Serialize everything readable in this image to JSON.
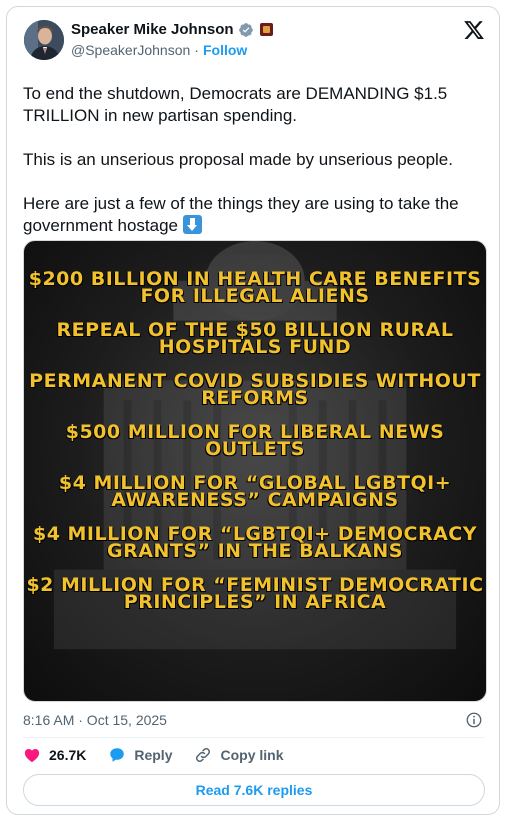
{
  "author": {
    "name": "Speaker Mike Johnson",
    "handle": "@SpeakerJohnson",
    "separator": "·",
    "follow_label": "Follow"
  },
  "tweet": {
    "paragraph_1": "To end the shutdown, Democrats are DEMANDING $1.5 TRILLION in new partisan spending.",
    "paragraph_2": "This is an unserious proposal made by unserious people.",
    "paragraph_3": "Here are just a few of the things they are using to take the government hostage"
  },
  "media": {
    "items": [
      "$200 BILLION IN HEALTH CARE BENEFITS FOR ILLEGAL ALIENS",
      "REPEAL OF THE $50 BILLION RURAL HOSPITALS FUND",
      "PERMANENT COVID SUBSIDIES WITHOUT REFORMS",
      "$500 MILLION FOR LIBERAL NEWS OUTLETS",
      "$4 MILLION FOR “GLOBAL LGBTQI+ AWARENESS” CAMPAIGNS",
      "$4 MILLION FOR “LGBTQI+ DEMOCRACY GRANTS” IN THE BALKANS",
      "$2 MILLION FOR “FEMINIST DEMOCRATIC PRINCIPLES” IN AFRICA"
    ],
    "text_color": "#f2c12e"
  },
  "meta": {
    "timestamp": "8:16 AM · Oct 15, 2025"
  },
  "actions": {
    "like_count": "26.7K",
    "reply_label": "Reply",
    "copy_link_label": "Copy link",
    "read_replies_label": "Read 7.6K replies"
  },
  "colors": {
    "accent": "#1d9bf0",
    "like": "#f91880",
    "verified": "#829aab"
  }
}
